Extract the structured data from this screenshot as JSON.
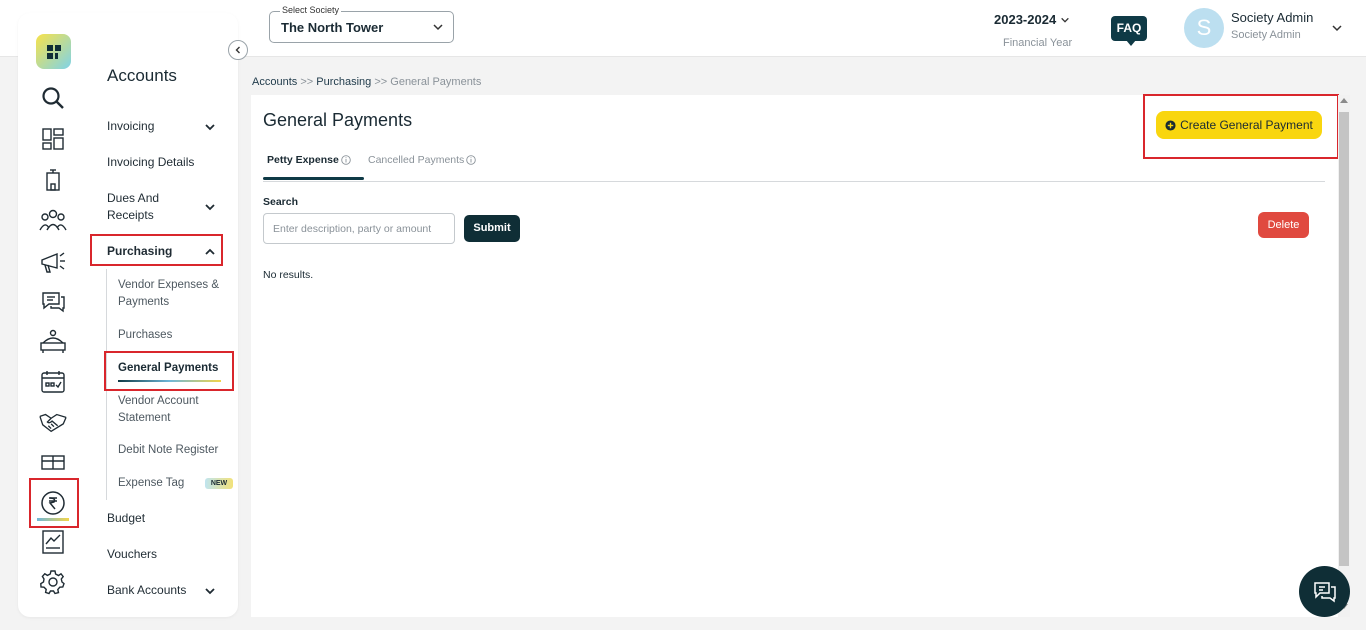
{
  "header": {
    "society_label": "Select Society",
    "society_value": "The North Tower",
    "financial_year": "2023-2024",
    "financial_year_label": "Financial Year",
    "faq_label": "FAQ",
    "user_initial": "S",
    "user_name": "Society Admin",
    "user_role": "Society Admin"
  },
  "rail_icons": [
    "logo-icon",
    "search-icon",
    "dashboard-icon",
    "building-icon",
    "members-icon",
    "announcement-icon",
    "chat-icon",
    "facility-icon",
    "calendar-icon",
    "handshake-icon",
    "gift-icon",
    "rupee-icon",
    "reports-icon",
    "settings-icon"
  ],
  "sidebar": {
    "title": "Accounts",
    "items": {
      "invoicing": "Invoicing",
      "invoicing_details": "Invoicing Details",
      "dues_line1": "Dues And",
      "dues_line2": "Receipts",
      "purchasing": "Purchasing",
      "vendor_exp_line1": "Vendor Expenses &",
      "vendor_exp_line2": "Payments",
      "purchases": "Purchases",
      "general_payments": "General Payments",
      "vendor_stmt_line1": "Vendor Account",
      "vendor_stmt_line2": "Statement",
      "debit_note": "Debit Note Register",
      "expense_tag": "Expense Tag",
      "new_badge": "NEW",
      "budget": "Budget",
      "vouchers": "Vouchers",
      "bank_accounts": "Bank Accounts"
    }
  },
  "breadcrumb": {
    "accounts": "Accounts",
    "sep": ">>",
    "purchasing": "Purchasing",
    "current": "General Payments"
  },
  "main": {
    "title": "General Payments",
    "create_button": "Create General Payment",
    "tabs": [
      {
        "label": "Petty Expense",
        "active": true
      },
      {
        "label": "Cancelled Payments",
        "active": false
      }
    ],
    "search_label": "Search",
    "search_placeholder": "Enter description, party or amount",
    "search_value": "",
    "submit_label": "Submit",
    "delete_label": "Delete",
    "empty_text": "No results."
  },
  "colors": {
    "accent_yellow": "#f9d60f",
    "dark_teal": "#0f2e36",
    "delete_red": "#e0493f",
    "highlight_red": "#d9262c"
  }
}
